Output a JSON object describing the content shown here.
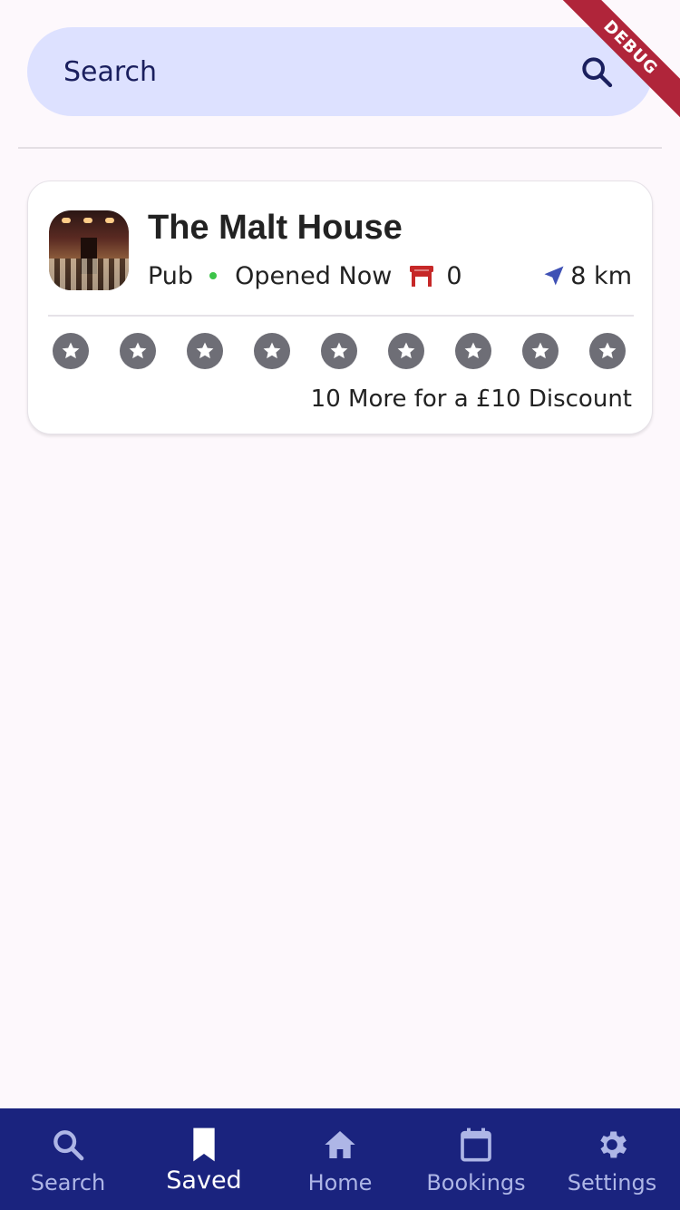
{
  "search": {
    "placeholder": "Search"
  },
  "venue": {
    "name": "The Malt House",
    "type": "Pub",
    "status": "Opened Now",
    "seats": "0",
    "distance": "8 km",
    "stamps_total": 9,
    "stamps_filled": 0,
    "discount_text": "10 More for a £10 Discount"
  },
  "debug_banner": "DEBUG",
  "nav": {
    "items": [
      {
        "label": "Search",
        "icon": "search-icon"
      },
      {
        "label": "Saved",
        "icon": "bookmark-icon",
        "active": true
      },
      {
        "label": "Home",
        "icon": "home-icon"
      },
      {
        "label": "Bookings",
        "icon": "calendar-icon"
      },
      {
        "label": "Settings",
        "icon": "gear-icon"
      }
    ]
  },
  "colors": {
    "accent": "#1a237e",
    "search_bg": "#dde1ff",
    "open_dot": "#3cc449",
    "seat_icon": "#c62828",
    "location_icon": "#3f51b5",
    "star_bg": "#6e6e76"
  }
}
